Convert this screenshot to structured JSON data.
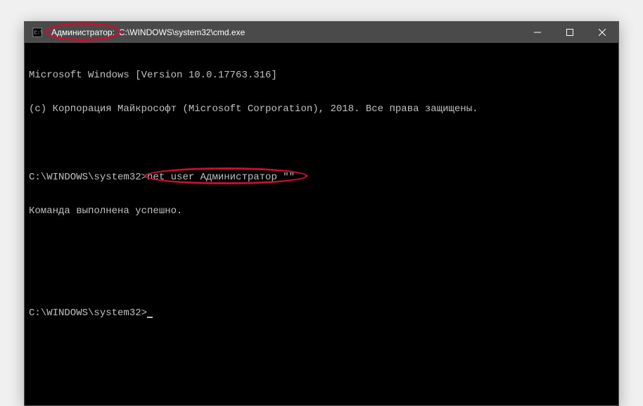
{
  "titlebar": {
    "prefix": "Администратор:",
    "path": "C:\\WINDOWS\\system32\\cmd.exe"
  },
  "terminal": {
    "line1": "Microsoft Windows [Version 10.0.17763.316]",
    "line2": "(c) Корпорация Майкрософт (Microsoft Corporation), 2018. Все права защищены.",
    "blank1": " ",
    "prompt1": "C:\\WINDOWS\\system32>",
    "command1": "net user Администратор \"\"",
    "result1": "Команда выполнена успешно.",
    "blank2": " ",
    "blank3": " ",
    "prompt2": "C:\\WINDOWS\\system32>"
  }
}
